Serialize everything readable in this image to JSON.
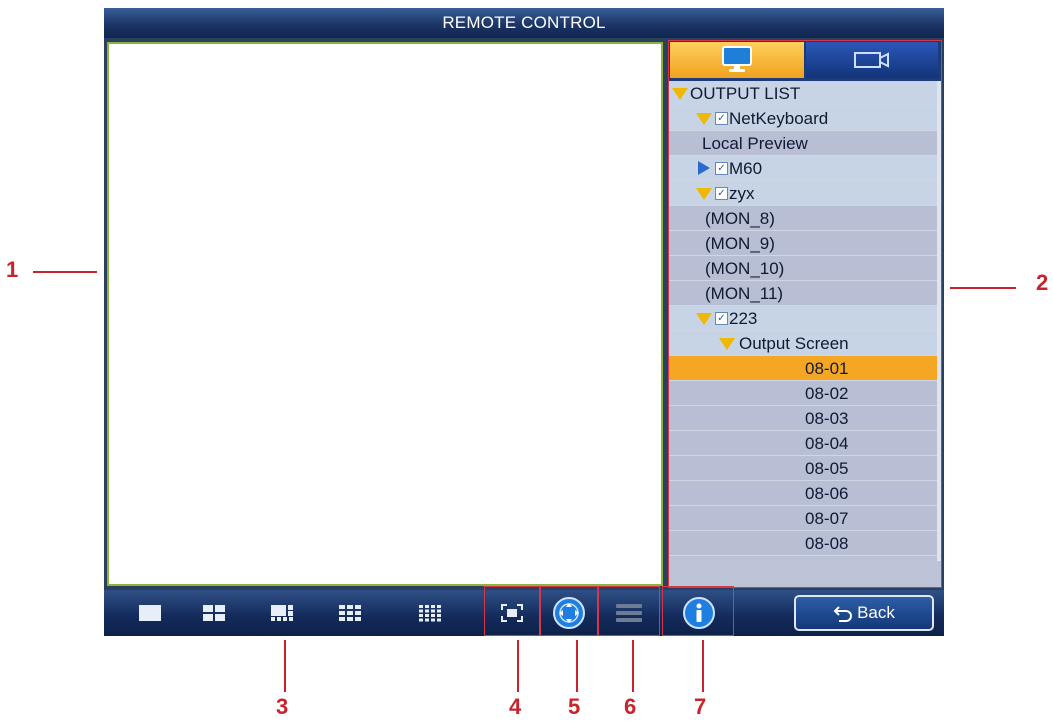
{
  "window": {
    "title": "REMOTE CONTROL"
  },
  "tabs": {
    "output_icon": "monitor-icon",
    "camera_icon": "camera-icon"
  },
  "tree": {
    "root": "OUTPUT LIST",
    "netkeyboard": "NetKeyboard",
    "local_preview": "Local Preview",
    "m60": "M60",
    "zyx": "zyx",
    "zyx_children": [
      "(MON_8)",
      "(MON_9)",
      "(MON_10)",
      "(MON_11)"
    ],
    "n223": "223",
    "output_screen": "Output Screen",
    "screens": [
      "08-01",
      "08-02",
      "08-03",
      "08-04",
      "08-05",
      "08-06",
      "08-07",
      "08-08"
    ],
    "selected": "08-01"
  },
  "toolbar": {
    "split_icons": [
      "split-1-icon",
      "split-4-icon",
      "split-6-icon",
      "split-9-icon",
      "split-16-icon"
    ],
    "fullscreen_icon": "fullscreen-icon",
    "ptz_icon": "ptz-direction-icon",
    "menu_icon": "menu-icon",
    "info_icon": "info-icon",
    "back_label": "Back"
  },
  "callouts": [
    "1",
    "2",
    "3",
    "4",
    "5",
    "6",
    "7"
  ]
}
